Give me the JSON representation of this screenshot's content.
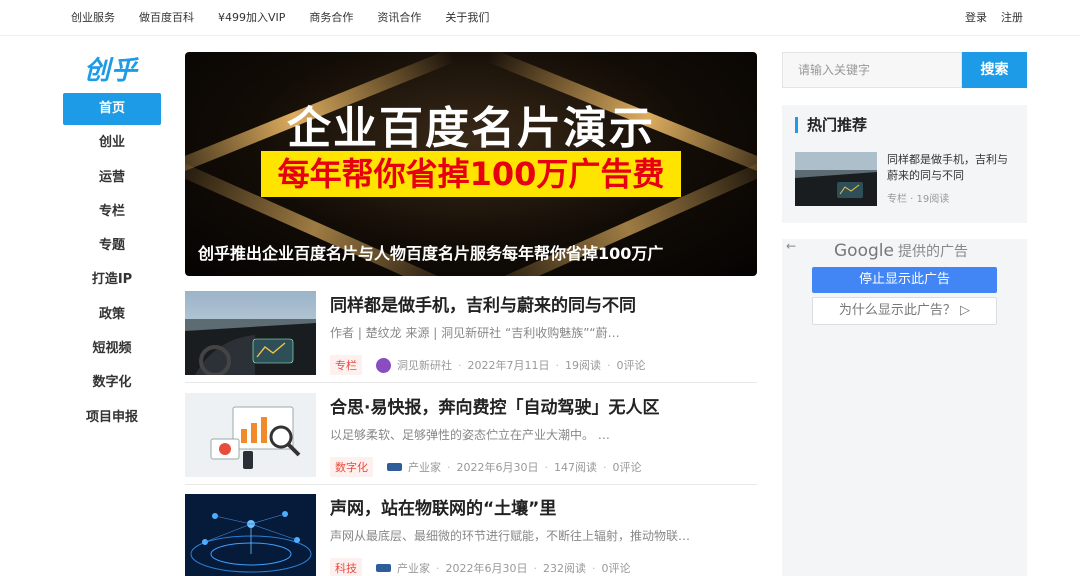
{
  "topnav": {
    "links": [
      "创业服务",
      "做百度百科",
      "¥499加入VIP",
      "商务合作",
      "资讯合作",
      "关于我们"
    ],
    "login": "登录",
    "register": "注册"
  },
  "logo": "创乎",
  "sidenav": {
    "items": [
      "首页",
      "创业",
      "运营",
      "专栏",
      "专题",
      "打造IP",
      "政策",
      "短视频",
      "数字化",
      "项目申报"
    ]
  },
  "hero": {
    "line1": "企业百度名片演示",
    "line2": "每年帮你省掉100万广告费",
    "caption": "创乎推出企业百度名片与人物百度名片服务每年帮你省掉100万广"
  },
  "articles": [
    {
      "title": "同样都是做手机，吉利与蔚来的同与不同",
      "desc": "作者 | 楚纹龙 来源 | 洞见新研社 “吉利收购魅族”“蔚…",
      "tag": "专栏",
      "source": "洞见新研社",
      "date": "2022年7月11日",
      "reads": "19阅读",
      "comments": "0评论"
    },
    {
      "title": "合思·易快报，奔向费控「自动驾驶」无人区",
      "desc": "以足够柔软、足够弹性的姿态伫立在产业大潮中。 …",
      "tag": "数字化",
      "source": "产业家",
      "date": "2022年6月30日",
      "reads": "147阅读",
      "comments": "0评论"
    },
    {
      "title": "声网，站在物联网的“土壤”里",
      "desc": "声网从最底层、最细微的环节进行赋能，不断往上辐射，推动物联…",
      "tag": "科技",
      "source": "产业家",
      "date": "2022年6月30日",
      "reads": "232阅读",
      "comments": "0评论"
    }
  ],
  "search": {
    "placeholder": "请输入关键字",
    "button": "搜索"
  },
  "hot": {
    "heading": "热门推荐",
    "title": "同样都是做手机，吉利与蔚来的同与不同",
    "meta": "专栏 · 19阅读"
  },
  "ad": {
    "back": "←",
    "google_word": "Google",
    "provided": "提供的广告",
    "stop": "停止显示此广告",
    "why": "为什么显示此广告？ ▷"
  },
  "colors": {
    "accent": "#1e9be6",
    "tag_red": "#e84c3d"
  }
}
